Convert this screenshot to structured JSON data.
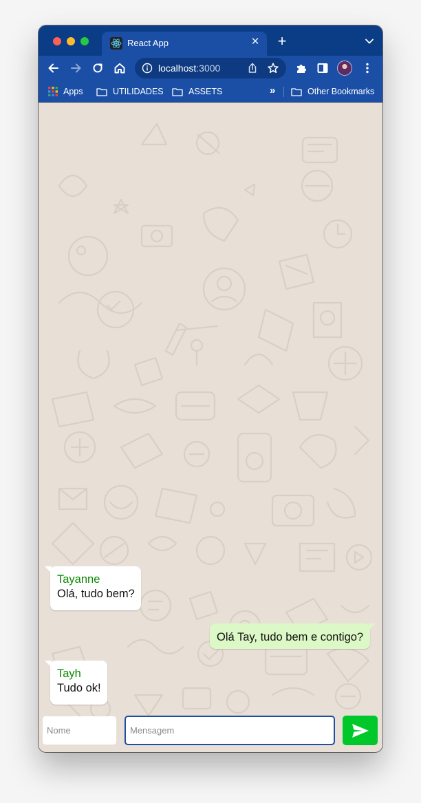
{
  "browser": {
    "tab_title": "React App",
    "url_host": "localhost",
    "url_port": ":3000",
    "bookmarks": {
      "apps": "Apps",
      "folders": [
        "UTILIDADES",
        "ASSETS"
      ],
      "other": "Other Bookmarks"
    }
  },
  "chat": {
    "messages": [
      {
        "author": "Tayanne",
        "text": "Olá, tudo bem?",
        "direction": "incoming"
      },
      {
        "author": "",
        "text": "Olá Tay, tudo bem e contigo?",
        "direction": "outgoing"
      },
      {
        "author": "Tayh",
        "text": "Tudo ok!",
        "direction": "incoming"
      }
    ],
    "name_placeholder": "Nome",
    "message_placeholder": "Mensagem"
  },
  "colors": {
    "author": "#0a8a00",
    "outgoing_bubble": "#dcf8c6",
    "send_button": "#00c82a",
    "chrome_bar": "#1b4fa6"
  },
  "icons": [
    "react-logo-icon",
    "close-icon",
    "plus-icon",
    "chevron-down-icon",
    "back-icon",
    "forward-icon",
    "reload-icon",
    "home-icon",
    "info-icon",
    "share-icon",
    "star-icon",
    "extensions-icon",
    "sidebar-icon",
    "more-icon",
    "apps-grid-icon",
    "folder-icon",
    "send-icon"
  ]
}
